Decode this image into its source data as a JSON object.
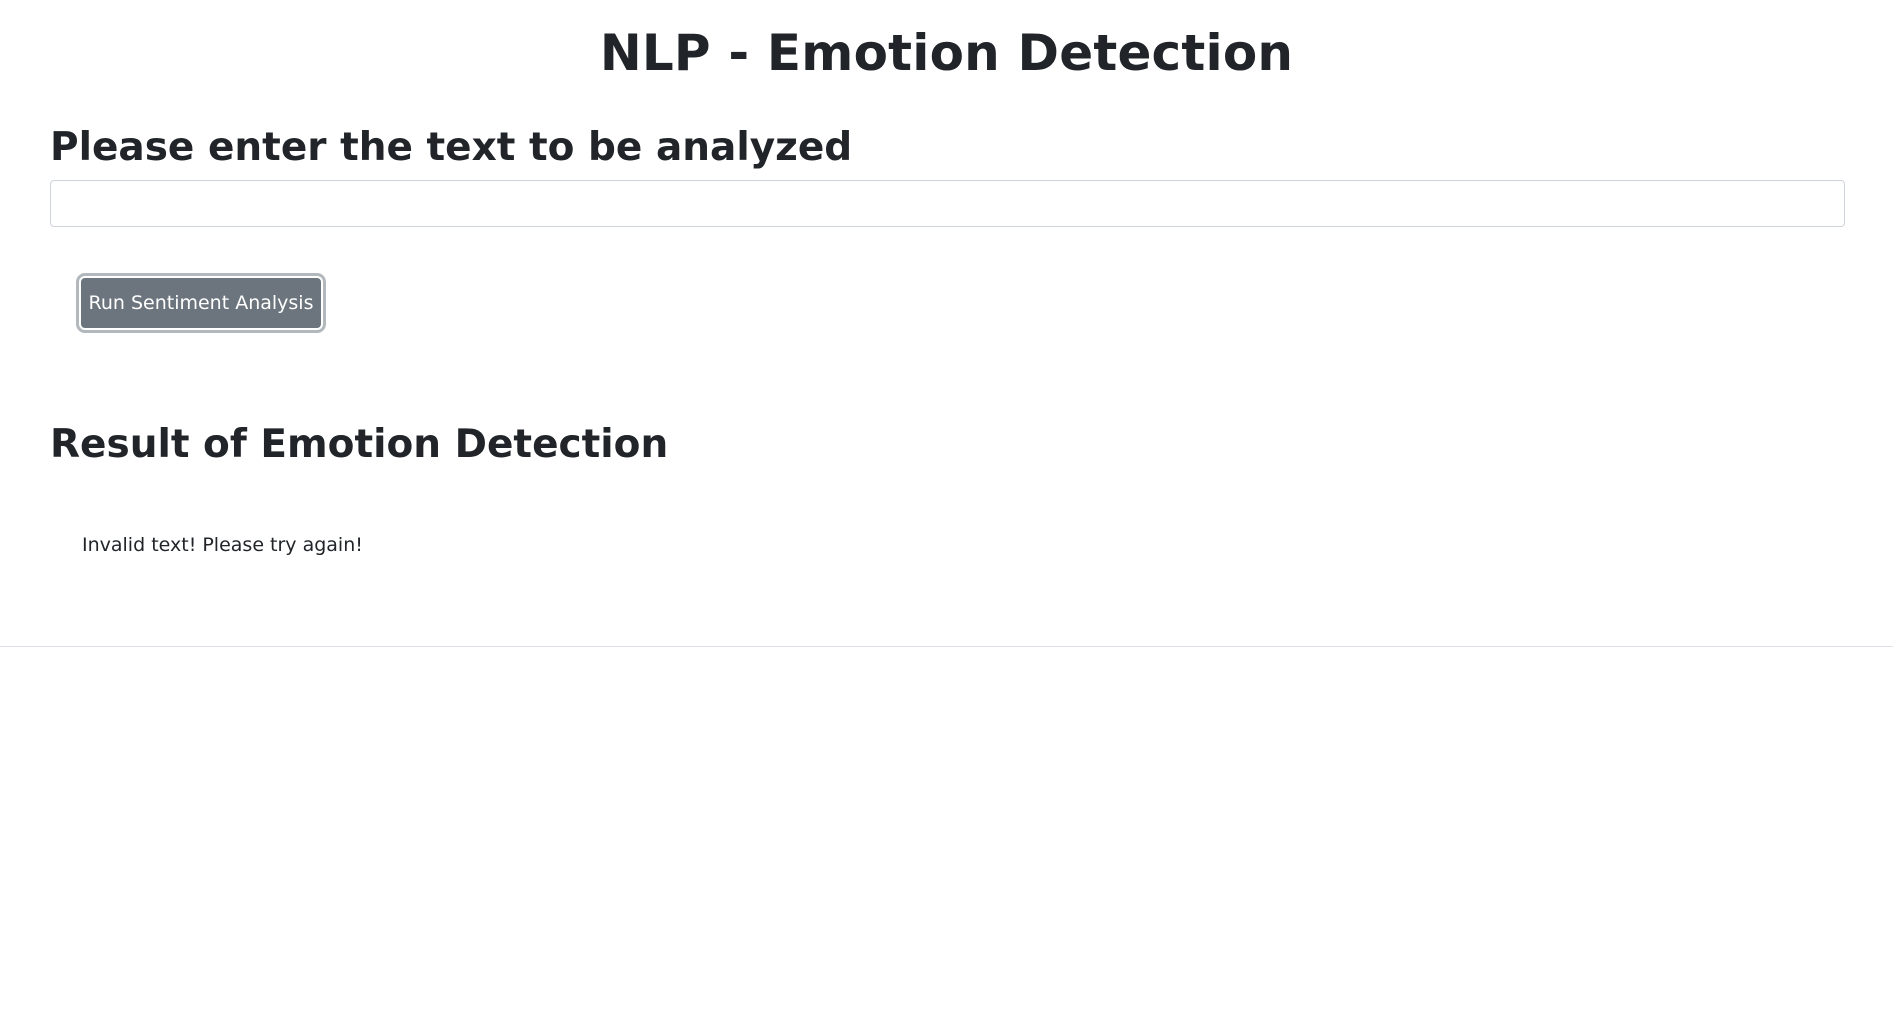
{
  "header": {
    "title": "NLP - Emotion Detection"
  },
  "form": {
    "prompt": "Please enter the text to be analyzed",
    "input_value": "",
    "input_placeholder": "",
    "button_label": "Run Sentiment Analysis"
  },
  "result": {
    "heading": "Result of Emotion Detection",
    "message": "Invalid text! Please try again!"
  },
  "colors": {
    "button_background": "#6c757d",
    "text": "#212529"
  }
}
